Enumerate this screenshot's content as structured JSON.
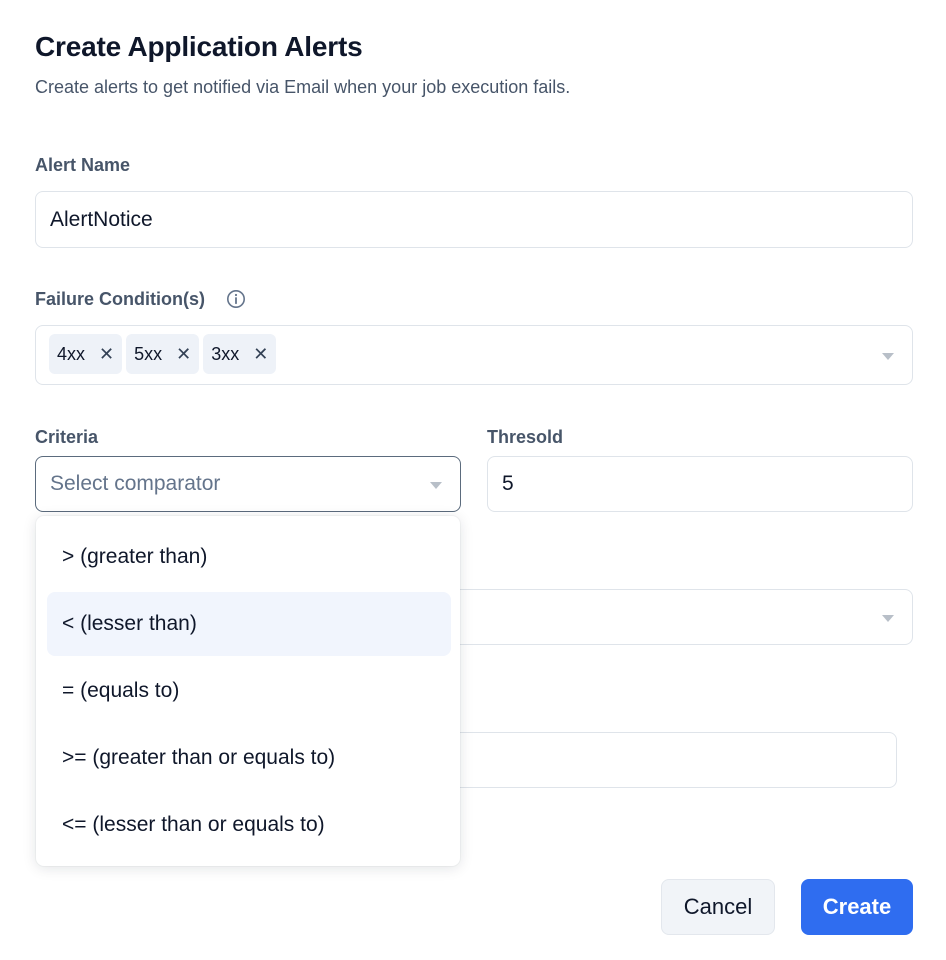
{
  "header": {
    "title": "Create Application Alerts",
    "subtitle": "Create alerts to get notified via Email when your job execution fails."
  },
  "alert_name": {
    "label": "Alert Name",
    "value": "AlertNotice"
  },
  "failure_conditions": {
    "label": "Failure Condition(s)",
    "info_icon": "info-icon",
    "chips": [
      "4xx",
      "5xx",
      "3xx"
    ],
    "remove_glyph": "✕"
  },
  "criteria": {
    "label": "Criteria",
    "placeholder": "Select comparator",
    "options": [
      "> (greater than)",
      "< (lesser than)",
      "= (equals to)",
      ">= (greater than or equals to)",
      "<= (lesser than or equals to)"
    ],
    "highlighted_index": 1
  },
  "threshold": {
    "label": "Thresold",
    "value": "5"
  },
  "buttons": {
    "cancel": "Cancel",
    "create": "Create"
  },
  "colors": {
    "primary": "#2f6df0",
    "option_highlight": "#f1f5fd",
    "chip_bg": "#eef2f8"
  }
}
